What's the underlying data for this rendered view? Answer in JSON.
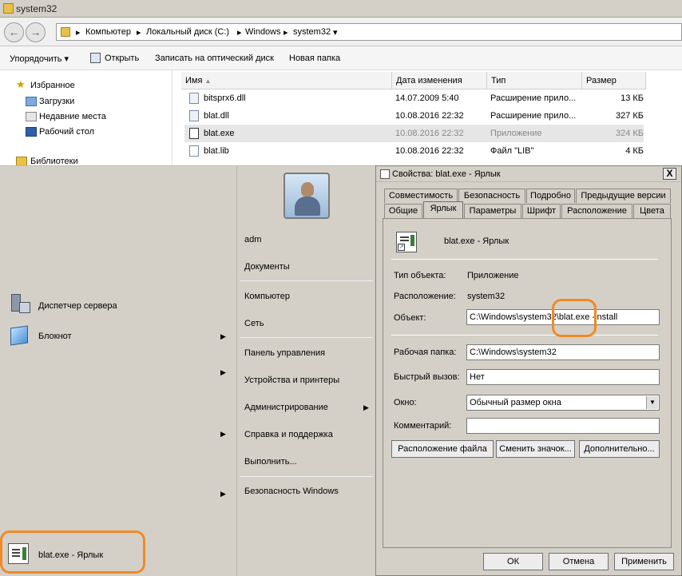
{
  "explorer": {
    "title": "system32",
    "breadcrumbs": [
      "Компьютер",
      "Локальный диск (C:)",
      "Windows",
      "system32"
    ],
    "toolbar": {
      "organize": "Упорядочить",
      "open": "Открыть",
      "burn": "Записать на оптический диск",
      "new_folder": "Новая папка"
    },
    "nav": {
      "favorites": "Избранное",
      "downloads": "Загрузки",
      "recent": "Недавние места",
      "desktop": "Рабочий стол",
      "libraries": "Библиотеки"
    },
    "columns": {
      "name": "Имя",
      "date": "Дата изменения",
      "type": "Тип",
      "size": "Размер"
    },
    "files": [
      {
        "name": "bitsprx6.dll",
        "date": "14.07.2009 5:40",
        "type": "Расширение прило...",
        "size": "13 КБ"
      },
      {
        "name": "blat.dll",
        "date": "10.08.2016 22:32",
        "type": "Расширение прило...",
        "size": "327 КБ"
      },
      {
        "name": "blat.exe",
        "date": "10.08.2016 22:32",
        "type": "Приложение",
        "size": "324 КБ"
      },
      {
        "name": "blat.lib",
        "date": "10.08.2016 22:32",
        "type": "Файл \"LIB\"",
        "size": "4 КБ"
      }
    ]
  },
  "startmenu": {
    "left": {
      "server_manager": "Диспетчер сервера",
      "notepad": "Блокнот",
      "pinned": "blat.exe - Ярлык"
    },
    "right": {
      "user": "adm",
      "documents": "Документы",
      "computer": "Компьютер",
      "network": "Сеть",
      "control_panel": "Панель управления",
      "devices": "Устройства и принтеры",
      "admin": "Администрирование",
      "help": "Справка и поддержка",
      "run": "Выполнить...",
      "security": "Безопасность Windows"
    }
  },
  "dialog": {
    "title": "Свойства: blat.exe - Ярлык",
    "close": "X",
    "tabs_row1": [
      "Совместимость",
      "Безопасность",
      "Подробно",
      "Предыдущие версии"
    ],
    "tabs_row2": [
      "Общие",
      "Ярлык",
      "Параметры",
      "Шрифт",
      "Расположение",
      "Цвета"
    ],
    "header_name": "blat.exe - Ярлык",
    "labels": {
      "object_type": "Тип объекта:",
      "location": "Расположение:",
      "target": "Объект:",
      "workdir": "Рабочая папка:",
      "hotkey": "Быстрый вызов:",
      "window": "Окно:",
      "comment": "Комментарий:"
    },
    "values": {
      "object_type": "Приложение",
      "location": "system32",
      "target": "C:\\Windows\\system32\\blat.exe -install",
      "workdir": "C:\\Windows\\system32",
      "hotkey": "Нет",
      "window": "Обычный размер окна",
      "comment": ""
    },
    "buttons": {
      "file_location": "Расположение файла",
      "change_icon": "Сменить значок...",
      "advanced": "Дополнительно...",
      "ok": "ОК",
      "cancel": "Отмена",
      "apply": "Применить"
    }
  },
  "colors": {
    "highlight": "#f08a24",
    "selection": "#e6e6e6",
    "face": "#d4d0c8"
  }
}
